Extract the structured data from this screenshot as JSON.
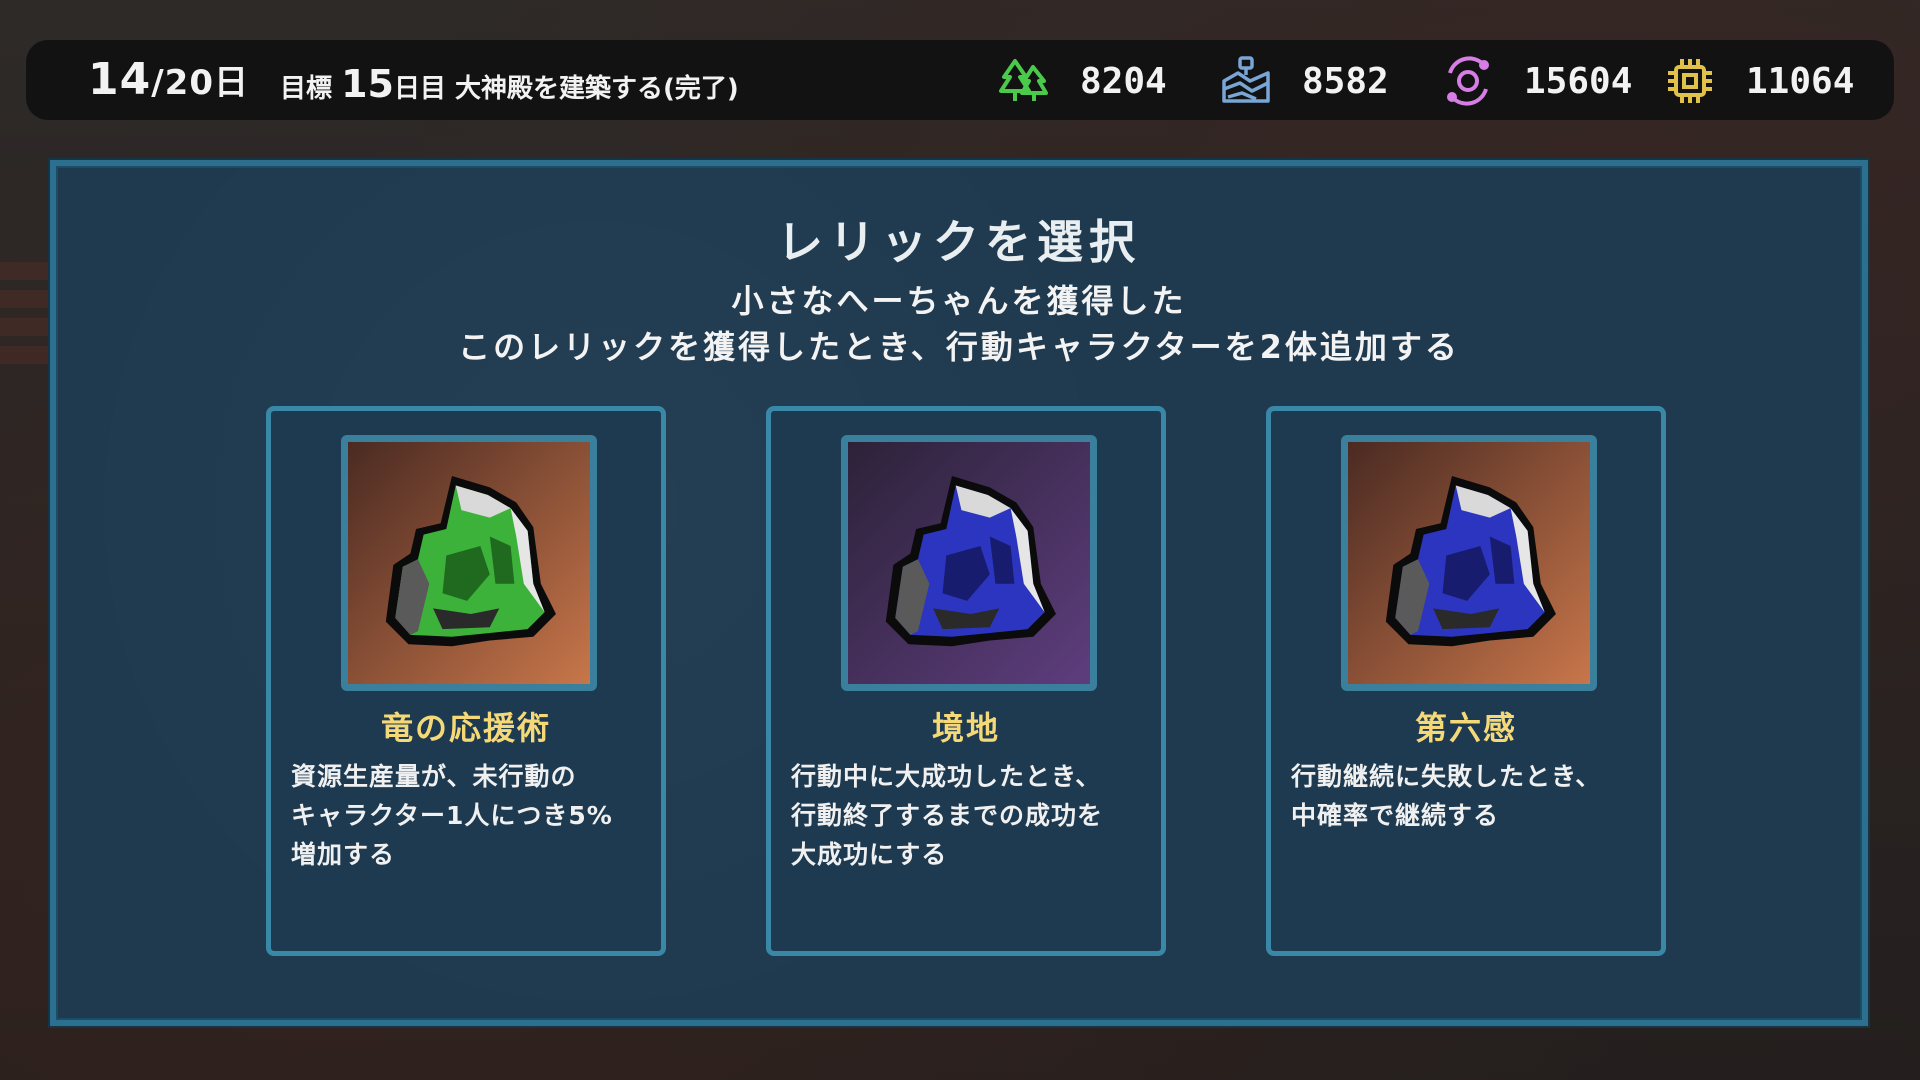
{
  "topbar": {
    "day_current": "14",
    "day_separator": "/",
    "day_total": "20日",
    "goal_prefix": "目標",
    "goal_day": "15",
    "goal_day_suffix": "日目",
    "goal_text": "大神殿を建築する(完了)",
    "resources": [
      {
        "icon": "tree-icon",
        "color": "#4bc94b",
        "value": "8204"
      },
      {
        "icon": "land-icon",
        "color": "#7aa6d6",
        "value": "8582"
      },
      {
        "icon": "orbit-icon",
        "color": "#d77ee6",
        "value": "15604"
      },
      {
        "icon": "chip-icon",
        "color": "#e0c24a",
        "value": "11064"
      }
    ]
  },
  "panel": {
    "title": "レリックを選択",
    "subtitle": "小さなへーちゃんを獲得した",
    "description": "このレリックを獲得したとき、行動キャラクターを2体追加する"
  },
  "cards": [
    {
      "name": "竜の応援術",
      "text": "資源生産量が、未行動の\nキャラクター1人につき5%\n増加する",
      "icon": "green-crystal-icon",
      "gem_color": "#3db23a",
      "gem_dark": "#1f6a1e",
      "bg_top": "#4a2a22",
      "bg_bottom": "#c8764a"
    },
    {
      "name": "境地",
      "text": "行動中に大成功したとき、\n行動終了するまでの成功を\n大成功にする",
      "icon": "blue-crystal-icon",
      "gem_color": "#2c35c0",
      "gem_dark": "#171c6e",
      "bg_top": "#2c2238",
      "bg_bottom": "#5e3d7e"
    },
    {
      "name": "第六感",
      "text": "行動継続に失敗したとき、\n中確率で継続する",
      "icon": "blue-crystal-icon",
      "gem_color": "#2c35c0",
      "gem_dark": "#171c6e",
      "bg_top": "#4a2a22",
      "bg_bottom": "#c8764a"
    }
  ]
}
